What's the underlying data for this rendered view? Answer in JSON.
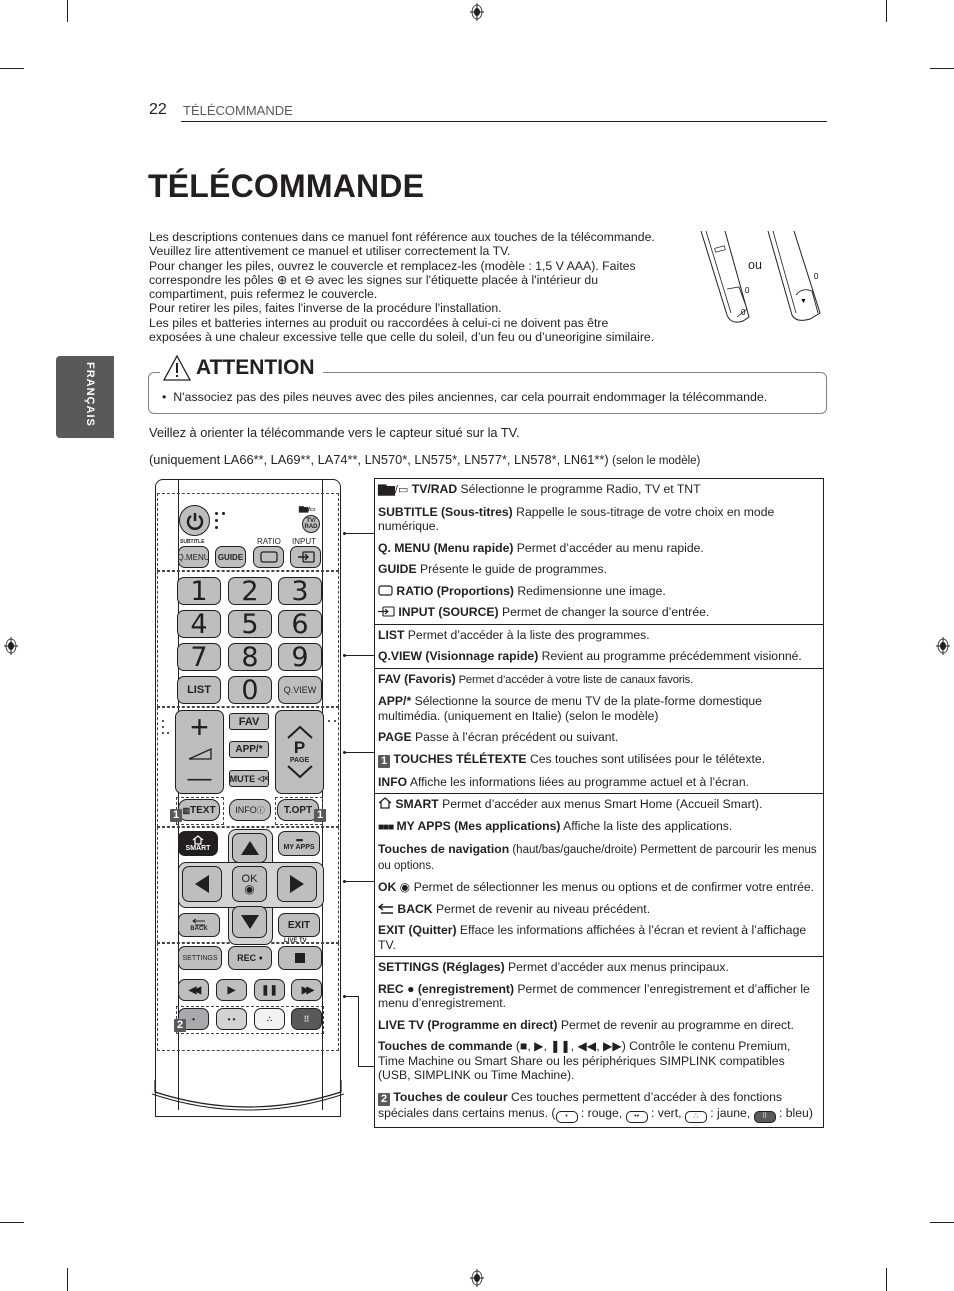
{
  "header": {
    "page_number": "22",
    "running_head": "TÉLÉCOMMANDE"
  },
  "title": "TÉLÉCOMMANDE",
  "side_tab": "FRANÇAIS",
  "intro": [
    "Les descriptions contenues dans ce manuel font référence aux touches de la télécommande.",
    "Veuillez lire attentivement ce manuel et utiliser correctement la TV.",
    "Pour changer les piles, ouvrez le couvercle et remplacez-les (modèle : 1,5 V AAA). Faites",
    "correspondre les pôles ⊕ et ⊖ avec les signes sur l'étiquette placée à l'intérieur du",
    "compartiment, puis refermez le couvercle.",
    "Pour retirer les piles, faites l'inverse de la procédure l'installation.",
    "Les piles et batteries internes au produit ou raccordées à celui-ci ne doivent pas être",
    "exposées à une chaleur excessive telle que celle du soleil, d’un feu ou d’uneorigine similaire."
  ],
  "battery_illustration": {
    "or_label": "ou"
  },
  "attention": {
    "icon": "warning-triangle-icon",
    "title": "ATTENTION",
    "items": [
      "N'associez pas des piles neuves avec des piles anciennes, car cela pourrait endommager la télécommande."
    ]
  },
  "orient_text": "Veillez à orienter la télécommande vers le capteur situé sur la TV.",
  "models": {
    "prefix": "(uniquement   LA66**, LA69**, LA74**, LN570*, LN575*, LN577*, LN578*, LN61**)",
    "suffix": "(selon le modèle)"
  },
  "remote": {
    "power": "power-icon",
    "tvrad_label": "TV/ RAD",
    "subtitle_label": "SUBTITLE",
    "qmenu": "Q.MENU",
    "guide": "GUIDE",
    "ratio_label": "RATIO",
    "input_label": "INPUT",
    "numbers": [
      "1",
      "2",
      "3",
      "4",
      "5",
      "6",
      "7",
      "8",
      "9"
    ],
    "list": "LIST",
    "zero": "0",
    "qview": "Q.VIEW",
    "vol_plus": "+",
    "vol_minus": "—",
    "fav": "FAV",
    "app": "APP/*",
    "mute": "MUTE",
    "page_p": "P",
    "page_label": "PAGE",
    "text": "TEXT",
    "info": "INFO",
    "topt": "T.OPT",
    "badge1": "1",
    "smart": "SMART",
    "myapps": "MY APPS",
    "ok": "OK",
    "back": "BACK",
    "exit": "EXIT",
    "livetv_label": "LIVE TV",
    "settings": "SETTINGS",
    "rec": "REC",
    "badge2": "2",
    "color_buttons": [
      {
        "name": "red",
        "color": "#a7a9ac",
        "mark": "•"
      },
      {
        "name": "green",
        "color": "#d1d3d4",
        "mark": "• •"
      },
      {
        "name": "yellow",
        "color": "#f1f2f2",
        "mark": "∴"
      },
      {
        "name": "blue",
        "color": "#58595b",
        "mark": "⠿"
      }
    ]
  },
  "descriptions": {
    "s1": [
      {
        "key": "TV/RAD",
        "text": " Sélectionne le programme Radio, TV et TNT"
      },
      {
        "key": "SUBTITLE (Sous-titres)",
        "text": " Rappelle le sous-titrage de votre choix en mode numérique."
      },
      {
        "key": "Q. MENU (Menu rapide)",
        "text": " Permet d’accéder au menu rapide."
      },
      {
        "key": "GUIDE",
        "text": " Présente le guide de programmes."
      },
      {
        "key": "RATIO (Proportions)",
        "text": " Redimensionne une image."
      },
      {
        "key": "INPUT (SOURCE)",
        "text": " Permet de changer la source d’entrée."
      }
    ],
    "s2": [
      {
        "key": "LIST",
        "text": " Permet d’accéder à la liste des programmes."
      },
      {
        "key": "Q.VIEW (Visionnage rapide)",
        "text": " Revient au programme précédemment visionné."
      }
    ],
    "s3": [
      {
        "key": "FAV (Favoris)",
        "text": " Permet d’accéder à votre liste de canaux favoris."
      },
      {
        "key": "APP/*",
        "text": " Sélectionne la source de menu TV de la plate-forme domestique multimédia. (uniquement en Italie) (selon le modèle)"
      },
      {
        "key": "PAGE",
        "text": " Passe à l’écran précédent ou suivant."
      },
      {
        "key": "TOUCHES TÉLÉTEXTE",
        "text": " Ces touches sont utilisées pour le télétexte.",
        "badge": "1"
      },
      {
        "key": "INFO",
        "text": " Affiche les informations liées au programme actuel et à l’écran."
      }
    ],
    "s4": [
      {
        "key": "SMART",
        "text": " Permet d’accéder aux menus Smart Home (Accueil Smart)."
      },
      {
        "key": "MY APPS (Mes applications)",
        "text": " Affiche la liste des applications."
      },
      {
        "key": "Touches de navigation",
        "text": " (haut/bas/gauche/droite) Permettent de parcourir les menus ou options."
      },
      {
        "key": "OK",
        "text": " Permet de sélectionner les menus ou options et de confirmer votre entrée."
      },
      {
        "key": "BACK",
        "text": " Permet de revenir au niveau précédent."
      },
      {
        "key": "EXIT (Quitter)",
        "text": " Efface les informations affichées à l’écran et revient à l’affichage TV."
      }
    ],
    "s5": [
      {
        "key": "SETTINGS (Réglages)",
        "text": " Permet d’accéder aux menus principaux."
      },
      {
        "key": "REC ● (enregistrement)",
        "text": "  Permet de commencer l’enregistrement et d’afficher le menu d’enregistrement."
      },
      {
        "key": "LIVE TV (Programme en direct)",
        "text": " Permet de revenir au programme en direct."
      },
      {
        "key": "Touches de commande",
        "text": " (■, ▶, ❚❚, ◀◀, ▶▶) Contrôle le contenu Premium, Time Machine ou Smart Share ou les périphériques SIMPLINK compatibles (USB, SIMPLINK ou Time Machine)."
      },
      {
        "key": "Touches de couleur",
        "text": " Ces touches permettent d’accéder à des fonctions spéciales dans certains menus.",
        "badge": "2"
      }
    ],
    "color_legend": [
      {
        "mark": "•",
        "label": " : rouge, "
      },
      {
        "mark": "••",
        "label": " : vert, "
      },
      {
        "mark": "∴",
        "label": " : jaune, "
      },
      {
        "mark": "⠿",
        "label": " : bleu)"
      }
    ]
  }
}
